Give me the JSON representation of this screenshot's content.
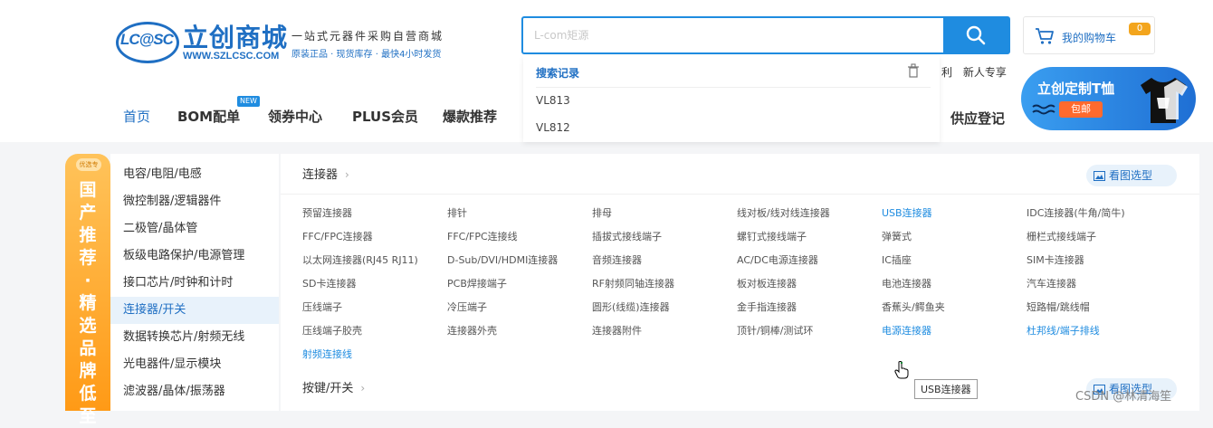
{
  "logo": {
    "badge": "LC@SC",
    "name": "立创商城",
    "url": "WWW.SZLCSC.COM"
  },
  "slogan": {
    "main": "一站式元器件采购自营商城",
    "sub": "原装正品 · 现货库存 · 最快4小时发货"
  },
  "search": {
    "placeholder": "L-com矩源",
    "history_title": "搜索记录",
    "history": [
      "VL813",
      "VL812"
    ]
  },
  "promo_links": [
    "利",
    "新人专享"
  ],
  "cart": {
    "label": "我的购物车",
    "count": "0"
  },
  "nav": {
    "items": [
      "首页",
      "BOM配单",
      "领券中心",
      "PLUS会员",
      "爆款推荐"
    ],
    "new_badge": "NEW",
    "right": "供应登记"
  },
  "banner": {
    "title": "立创定制T恤",
    "button": "包邮"
  },
  "side_banner": {
    "tag": "优选专",
    "text": "国产推荐·精选品牌低至"
  },
  "menu": {
    "items": [
      "电容/电阻/电感",
      "微控制器/逻辑器件",
      "二极管/晶体管",
      "板级电路保护/电源管理",
      "接口芯片/时钟和计时",
      "连接器/开关",
      "数据转换芯片/射频无线",
      "光电器件/显示模块",
      "滤波器/晶体/振荡器"
    ],
    "active_index": 5
  },
  "panel": {
    "title": "连接器",
    "image_select": "看图选型",
    "categories": [
      [
        "预留连接器",
        "排针",
        "排母",
        "线对板/线对线连接器",
        "USB连接器",
        "IDC连接器(牛角/简牛)"
      ],
      [
        "FFC/FPC连接器",
        "FFC/FPC连接线",
        "插拔式接线端子",
        "螺钉式接线端子",
        "弹簧式",
        "栅栏式接线端子"
      ],
      [
        "以太网连接器(RJ45 RJ11)",
        "D-Sub/DVI/HDMI连接器",
        "音频连接器",
        "AC/DC电源连接器",
        "IC插座",
        "SIM卡连接器"
      ],
      [
        "SD卡连接器",
        "PCB焊接端子",
        "RF射频同轴连接器",
        "板对板连接器",
        "电池连接器",
        "汽车连接器"
      ],
      [
        "压线端子",
        "冷压端子",
        "圆形(线缆)连接器",
        "金手指连接器",
        "香蕉头/鳄鱼夹",
        "短路帽/跳线帽"
      ],
      [
        "压线端子胶壳",
        "连接器外壳",
        "连接器附件",
        "顶针/铜棒/测试环",
        "电源连接器",
        "杜邦线/端子排线"
      ],
      [
        "射频连接线"
      ]
    ],
    "blue_categories": [
      "USB连接器",
      "电源连接器",
      "杜邦线/端子排线",
      "射频连接线"
    ],
    "tooltip": "USB连接器",
    "second_title": "按键/开关",
    "second_image_select": "看图选型"
  },
  "watermark": "CSDN @林清海笙",
  "colors": {
    "brand": "#1f6fc3",
    "accent": "#1f8ce0",
    "orange": "#ff9a16"
  }
}
